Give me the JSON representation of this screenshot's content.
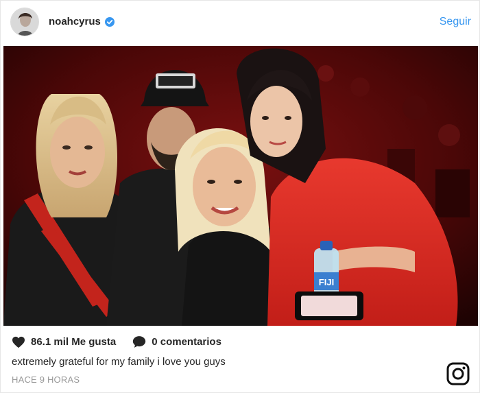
{
  "header": {
    "username": "noahcyrus",
    "follow_label": "Seguir"
  },
  "photo": {
    "bottle_label": "FIJI"
  },
  "actions": {
    "likes": "86.1 mil Me gusta",
    "comments": "0 comentarios"
  },
  "caption": "extremely grateful for my family i love you guys",
  "timestamp": "HACE 9 HORAS",
  "colors": {
    "accent": "#3897f0",
    "text": "#262626",
    "muted": "#999999",
    "verified": "#3897f0"
  },
  "icons": [
    "avatar",
    "verified-badge-icon",
    "heart-icon",
    "comment-icon",
    "instagram-logo-icon"
  ]
}
